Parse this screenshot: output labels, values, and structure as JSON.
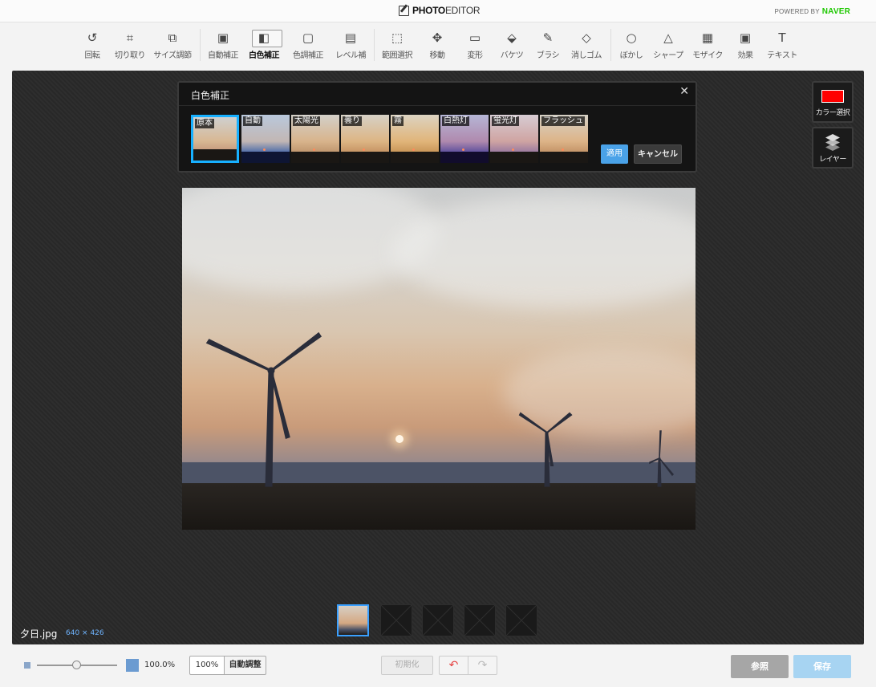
{
  "header": {
    "logo_bold": "PHOTO",
    "logo_rest": "EDITOR",
    "powered_by": "POWERED BY",
    "powered_brand": "NAVER"
  },
  "toolbar": {
    "tools": [
      {
        "label": "回転",
        "icon": "rotate-icon"
      },
      {
        "label": "切り取り",
        "icon": "crop-icon"
      },
      {
        "label": "サイズ調節",
        "icon": "resize-icon"
      },
      {
        "label": "自動補正",
        "icon": "auto-correct-icon"
      },
      {
        "label": "白色補正",
        "icon": "white-balance-icon",
        "active": true
      },
      {
        "label": "色調補正",
        "icon": "color-tone-icon"
      },
      {
        "label": "レベル補",
        "icon": "levels-icon"
      },
      {
        "label": "範囲選択",
        "icon": "selection-icon"
      },
      {
        "label": "移動",
        "icon": "move-icon"
      },
      {
        "label": "変形",
        "icon": "transform-icon"
      },
      {
        "label": "バケツ",
        "icon": "bucket-icon"
      },
      {
        "label": "ブラシ",
        "icon": "brush-icon"
      },
      {
        "label": "消しゴム",
        "icon": "eraser-icon"
      },
      {
        "label": "ぼかし",
        "icon": "blur-icon"
      },
      {
        "label": "シャープ",
        "icon": "sharpen-icon"
      },
      {
        "label": "モザイク",
        "icon": "mosaic-icon"
      },
      {
        "label": "効果",
        "icon": "effects-icon"
      },
      {
        "label": "テキスト",
        "icon": "text-icon"
      }
    ]
  },
  "wb_panel": {
    "title": "白色補正",
    "presets": [
      {
        "label": "原本",
        "selected": true
      },
      {
        "label": "自動"
      },
      {
        "label": "太陽光"
      },
      {
        "label": "曇り"
      },
      {
        "label": "霧"
      },
      {
        "label": "白熱灯"
      },
      {
        "label": "蛍光灯"
      },
      {
        "label": "フラッシュ"
      }
    ],
    "apply_label": "適用",
    "cancel_label": "キャンセル"
  },
  "side_panel": {
    "color_label": "カラー選択",
    "color_value": "#ff0000",
    "layer_label": "レイヤー"
  },
  "canvas": {
    "filename": "夕日.jpg",
    "dimensions": "640 × 426"
  },
  "bottom": {
    "zoom": "100.0%",
    "btn_100": "100%",
    "btn_auto": "自動調整",
    "btn_reset": "初期化",
    "btn_browse": "参照",
    "btn_save": "保存"
  },
  "colors": {
    "accent": "#17b0ff",
    "apply": "#4aa2e8",
    "save": "#a7d4f2"
  }
}
